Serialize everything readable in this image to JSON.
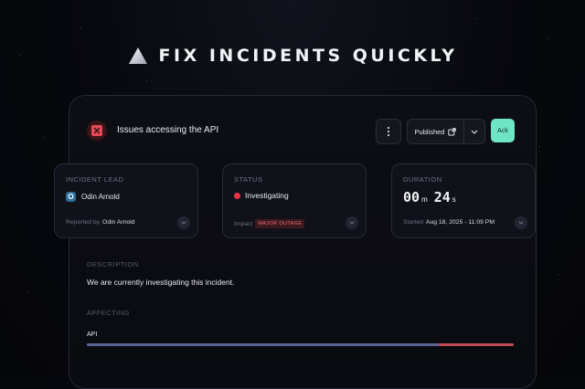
{
  "headline": {
    "text": "FIX INCIDENTS QUICKLY"
  },
  "incident": {
    "title": "Issues accessing the API"
  },
  "toolbar": {
    "published_label": "Published",
    "ack_label": "Ack"
  },
  "cards": {
    "lead": {
      "label": "INCIDENT LEAD",
      "avatar_letter": "O",
      "name": "Odin Arnold",
      "reported_prefix": "Reported by",
      "reported_by": "Odin Arnold"
    },
    "status": {
      "label": "STATUS",
      "value": "Investigating",
      "impact_prefix": "Impact",
      "impact_badge": "MAJOR OUTAGE"
    },
    "duration": {
      "label": "DURATION",
      "minutes": "00",
      "minutes_unit": "m",
      "seconds": "24",
      "seconds_unit": "s",
      "started_prefix": "Started",
      "started_value": "Aug 18, 2025 - 11:09 PM"
    }
  },
  "description": {
    "label": "DESCRIPTION",
    "text": "We are currently investigating this incident."
  },
  "affecting": {
    "label": "AFFECTING",
    "item": "API",
    "healthy_fraction": 0.825
  },
  "colors": {
    "accent_ack": "#6ee6c4",
    "status_red": "#ee3340",
    "bar_ok": "#5a6298",
    "bar_bad": "#c34955"
  }
}
